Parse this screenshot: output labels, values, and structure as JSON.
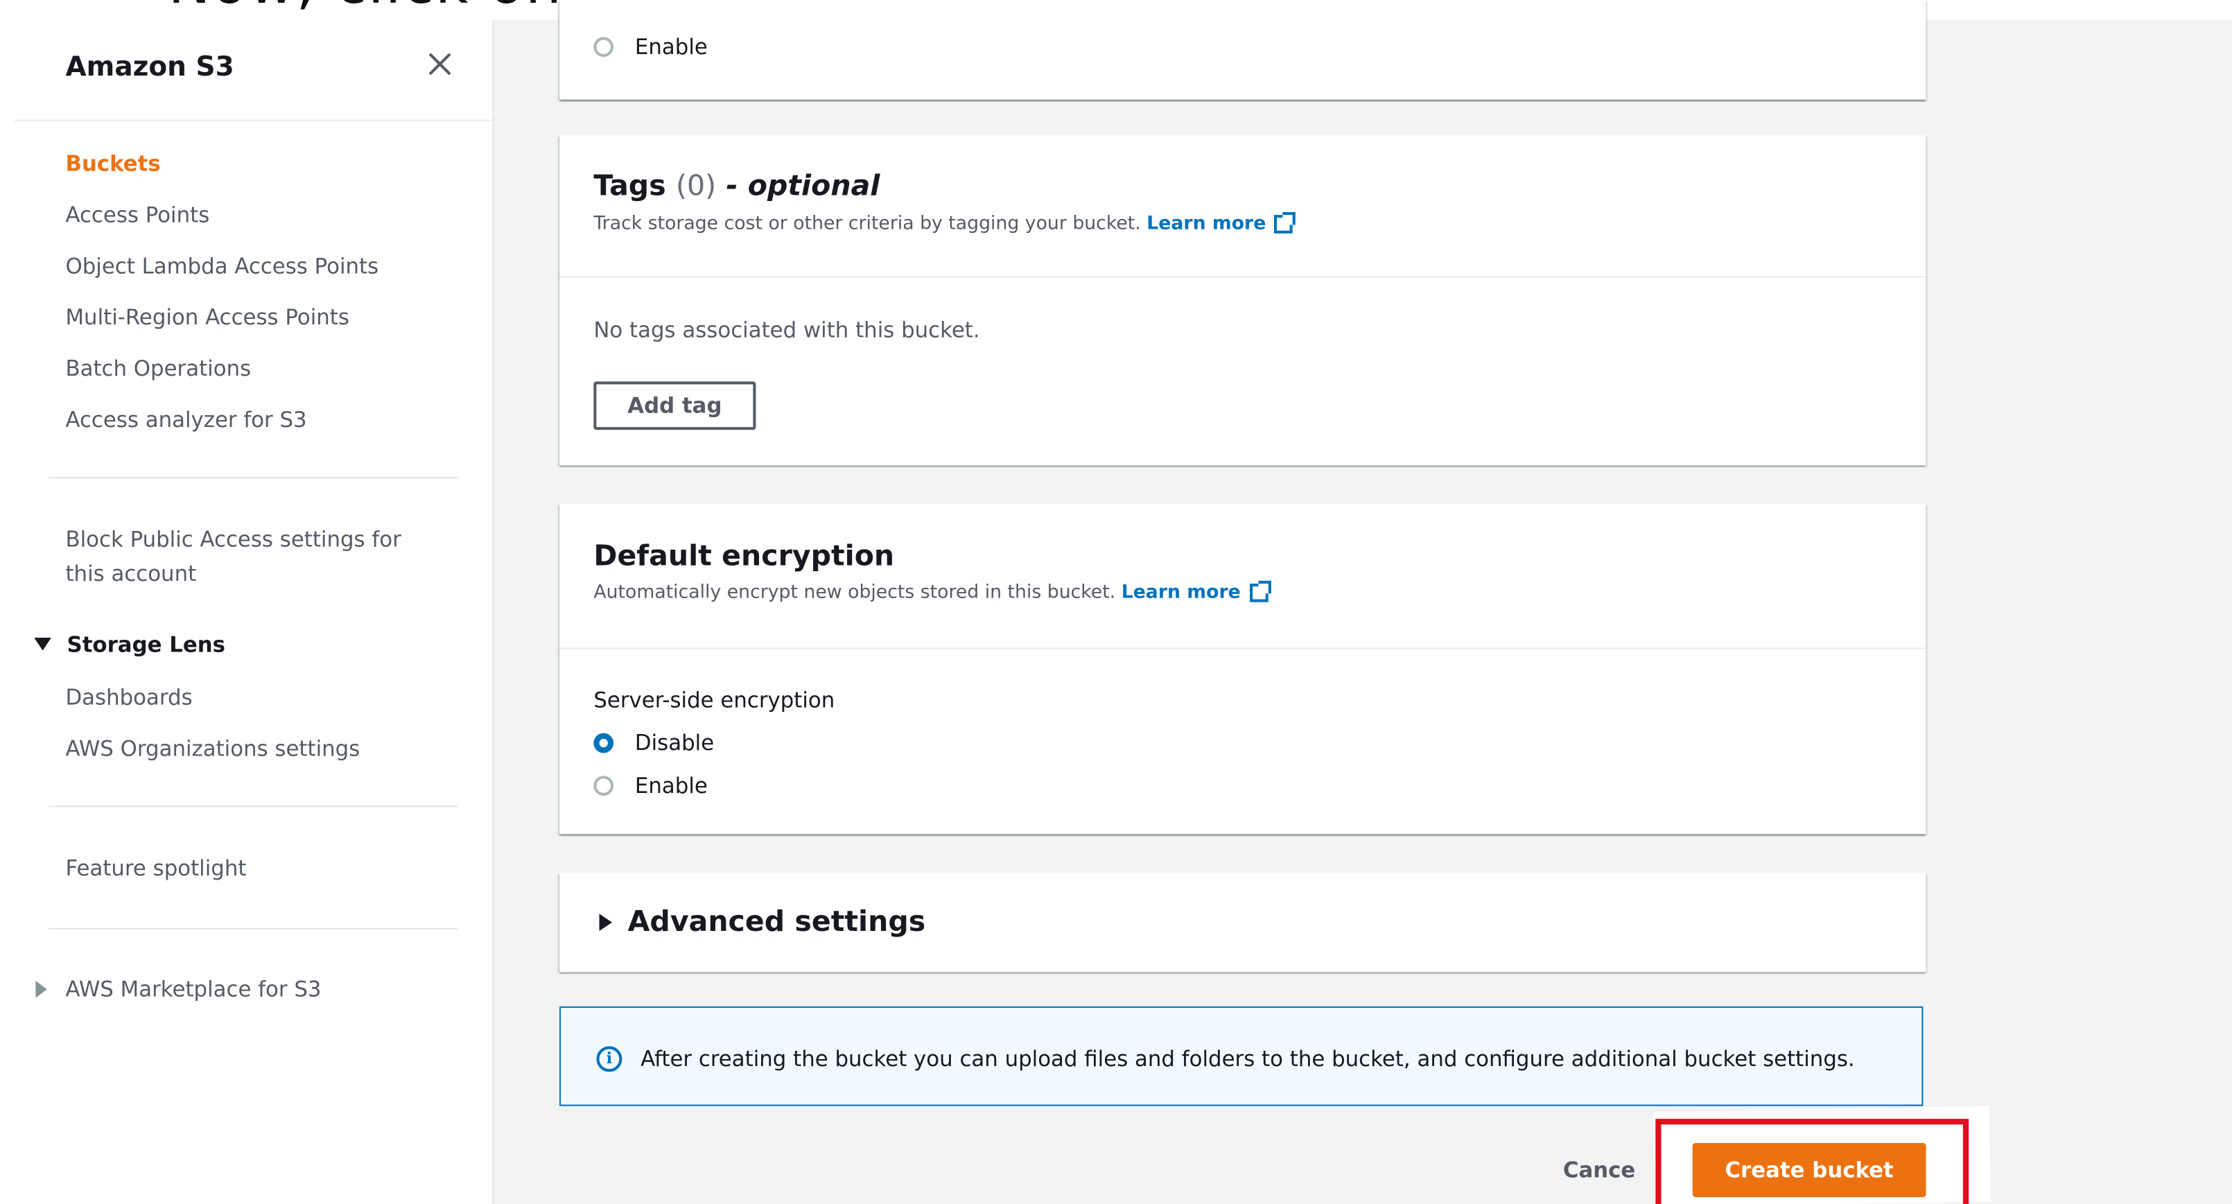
{
  "caption": "Now, click on Create Bucket",
  "sidebar": {
    "title": "Amazon S3",
    "items": [
      "Buckets",
      "Access Points",
      "Object Lambda Access Points",
      "Multi-Region Access Points",
      "Batch Operations",
      "Access analyzer for S3"
    ],
    "block_public_access_line1": "Block Public Access settings for",
    "block_public_access_line2": "this account",
    "storage_lens": "Storage Lens",
    "storage_lens_items": [
      "Dashboards",
      "AWS Organizations settings"
    ],
    "feature_spotlight": "Feature spotlight",
    "marketplace": "AWS Marketplace for S3"
  },
  "top_card": {
    "enable_label": "Enable"
  },
  "tags": {
    "title": "Tags",
    "count": "(0)",
    "optional": "- optional",
    "description": "Track storage cost or other criteria by tagging your bucket.",
    "learn_more": "Learn more",
    "empty_text": "No tags associated with this bucket.",
    "add_tag_button": "Add tag"
  },
  "encryption": {
    "title": "Default encryption",
    "description": "Automatically encrypt new objects stored in this bucket.",
    "learn_more": "Learn more",
    "field_label": "Server-side encryption",
    "options": [
      "Disable",
      "Enable"
    ],
    "selected": "Disable"
  },
  "advanced": {
    "title": "Advanced settings"
  },
  "info": {
    "icon": "i",
    "text": "After creating the bucket you can upload files and folders to the bucket, and configure additional bucket settings."
  },
  "footer": {
    "cancel": "Cance",
    "create": "Create bucket"
  },
  "colors": {
    "accent": "#ec7211",
    "link": "#0073bb",
    "highlight": "#e00f1e"
  }
}
